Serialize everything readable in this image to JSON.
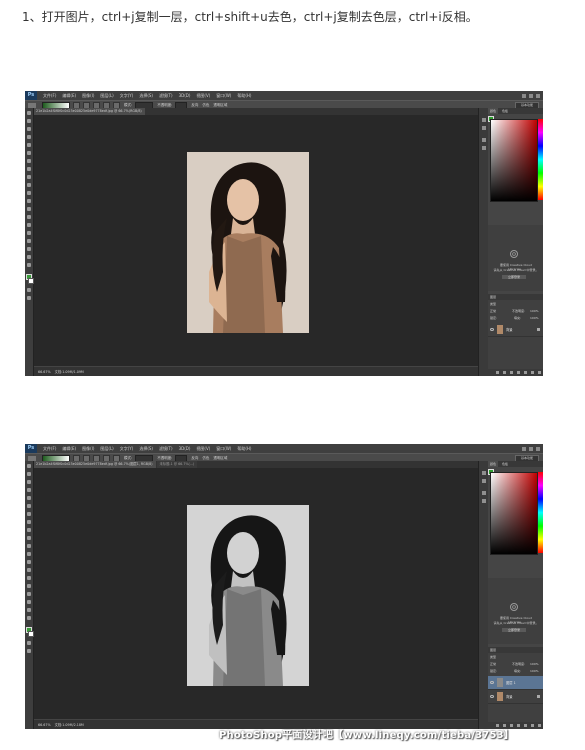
{
  "instruction": "1、打开图片，ctrl+j复制一层，ctrl+shift+u去色，ctrl+j复制去色层，ctrl+i反相。",
  "watermark": "PhotoShop平面设计吧【www.lineqy.com/tieba/3753】",
  "app_logo": "Ps",
  "menu": [
    "文件(F)",
    "编辑(E)",
    "图像(I)",
    "图层(L)",
    "文字(Y)",
    "选择(S)",
    "滤镜(T)",
    "3D(D)",
    "视图(V)",
    "窗口(W)",
    "帮助(H)"
  ],
  "options_bar": {
    "mode_label": "模式:",
    "mode_value": "正常",
    "opacity_label": "不透明度:",
    "opacity_value": "100%",
    "reverse_label": "反向",
    "dither_label": "仿色",
    "transparency_label": "透明区域",
    "workspace": "基本功能"
  },
  "colors": {
    "foreground": "#3b9b3b",
    "background": "#ffffff",
    "picker_base": "#c00000",
    "layer_selected": "#5b7594"
  },
  "screenshots": [
    {
      "tabs": [
        {
          "label": "21e1b2a4f0f8f0c0d23e00825e0de9778edf.jpg @ 66.7%(RGB/8)",
          "active": true
        }
      ],
      "zoom": "66.67%",
      "doc_size": "文档:1.09M/1.09M",
      "photo_mode": "color",
      "layers": [
        {
          "name": "背景",
          "selected": false,
          "locked": true
        }
      ]
    },
    {
      "tabs": [
        {
          "label": "21e1b2a4f0f8f0c0d23e00825e0de9778edf.jpg @ 66.7%(图层1, RGB/8)",
          "active": true
        },
        {
          "label": "未标题-1 @ 66.7%(...)",
          "active": false
        }
      ],
      "zoom": "66.67%",
      "doc_size": "文档:1.09M/2.18M",
      "photo_mode": "grayscale",
      "layers": [
        {
          "name": "图层 1",
          "selected": true,
          "locked": false
        },
        {
          "name": "背景",
          "selected": false,
          "locked": true
        }
      ]
    }
  ],
  "panels": {
    "color_tab": "颜色",
    "swatches_tab": "色板",
    "cc_title": "Creative Cloud Libraries",
    "cc_line1": "要使用 Creative Cloud Libraries，",
    "cc_line2": "请先从 Creative Cloud 中登录。",
    "cc_button": "立即登录",
    "layers_tab": "图层",
    "kind_label": "类型",
    "blend_mode": "正常",
    "opacity_label": "不透明度:",
    "opacity_value": "100%",
    "lock_label": "锁定:",
    "fill_label": "填充:",
    "fill_value": "100%"
  }
}
